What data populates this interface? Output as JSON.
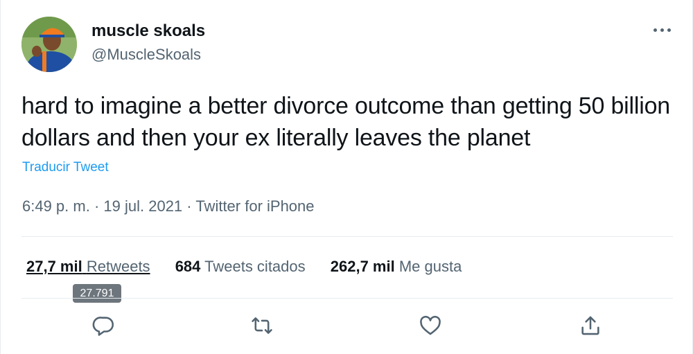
{
  "user": {
    "name": "muscle skoals",
    "handle": "@MuscleSkoals"
  },
  "tweet": {
    "text": "hard to imagine a better divorce outcome than getting 50 billion dollars and then your ex literally leaves the planet",
    "translate_label": "Traducir Tweet",
    "time": "6:49 p. m.",
    "separator": " · ",
    "date": "19 jul. 2021",
    "source": "Twitter for iPhone"
  },
  "stats": {
    "retweets_count": "27,7 mil",
    "retweets_label": "Retweets",
    "quotes_count": "684",
    "quotes_label": "Tweets citados",
    "likes_count": "262,7 mil",
    "likes_label": "Me gusta"
  },
  "tooltip": {
    "text": "27.791"
  },
  "actions": [
    {
      "icon": "reply-icon"
    },
    {
      "icon": "retweet-icon"
    },
    {
      "icon": "like-icon"
    },
    {
      "icon": "share-icon"
    }
  ],
  "colors": {
    "link": "#1d9bf0",
    "secondary_text": "#536471",
    "primary_text": "#0f1419"
  }
}
